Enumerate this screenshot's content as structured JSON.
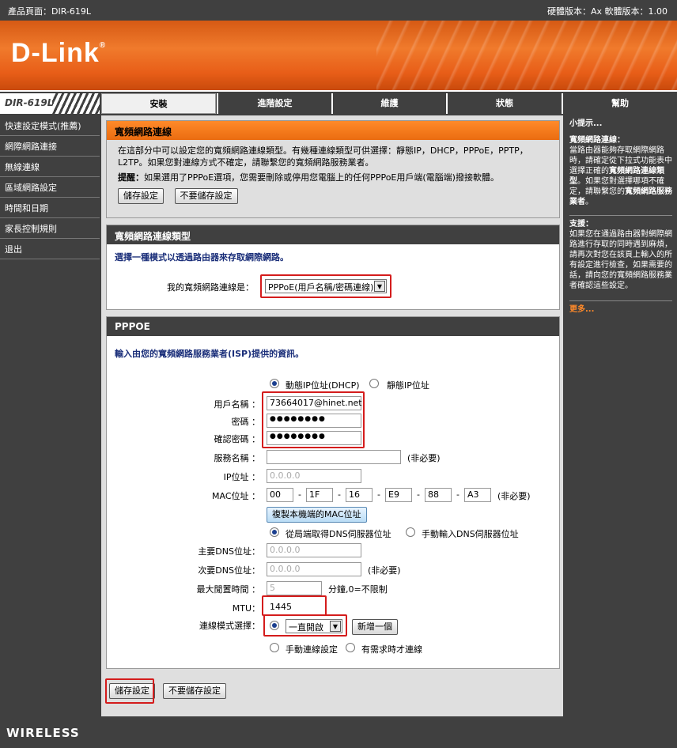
{
  "topbar": {
    "product": "產品頁面：DIR-619L",
    "version": "硬體版本：Ax   軟體版本：1.00"
  },
  "logo": {
    "text": "D-Link",
    "reg": "®"
  },
  "model": "DIR-619L",
  "tabs": [
    "安裝",
    "進階設定",
    "維護",
    "狀態",
    "幫助"
  ],
  "leftmenu": [
    "快速設定模式(推薦)",
    "網際網路連接",
    "無線連線",
    "區域網路設定",
    "時間和日期",
    "家長控制規則",
    "退出"
  ],
  "section1": {
    "title": "寬頻網路連線",
    "desc": "在這部分中可以設定您的寬頻網路連線類型。有幾種連線類型可供選擇：靜態IP，DHCP，PPPoE，PPTP，L2TP。如果您對連線方式不確定，請聯繫您的寬頻網路服務業者。",
    "note_label": "提醒：",
    "note": "如果選用了PPPoE選項，您需要刪除或停用您電腦上的任何PPPoE用戶端(電腦端)撥接軟體。",
    "save": "儲存設定",
    "nosave": "不要儲存設定"
  },
  "section2": {
    "title": "寬頻網路連線類型",
    "subtitle": "選擇一種模式以透過路由器來存取網際網路。",
    "label": "我的寬頻網路連線是：",
    "value": "PPPoE(用戶名稱/密碼連線)"
  },
  "section3": {
    "title": "PPPOE",
    "subtitle": "輸入由您的寬頻網路服務業者(ISP)提供的資訊。",
    "dhcp": "動態IP位址(DHCP)",
    "static": "靜態IP位址",
    "username_label": "用戶名稱 ：",
    "username": "73664017@hinet.net",
    "password_label": "密碼 ：",
    "password": "●●●●●●●●",
    "confirm_label": "確認密碼 ：",
    "confirm": "●●●●●●●●",
    "service_label": "服務名稱 ：",
    "optional": "(非必要)",
    "ip_label": "IP位址 ：",
    "ip_placeholder": "0.0.0.0",
    "mac_label": "MAC位址 ：",
    "mac": [
      "00",
      "1F",
      "16",
      "E9",
      "88",
      "A3"
    ],
    "mac_sep": "-",
    "clone": "複製本機端的MAC位址",
    "dns_auto": "從局端取得DNS伺服器位址",
    "dns_manual": "手動輸入DNS伺服器位址",
    "dns1_label": "主要DNS位址：",
    "dns2_label": "次要DNS位址：",
    "dns_placeholder": "0.0.0.0",
    "idle_label": "最大閒置時間 ：",
    "idle": "5",
    "idle_unit": "分鐘,0=不限制",
    "mtu_label": "MTU：",
    "mtu": "1445",
    "mode_label": "連線模式選擇：",
    "mode_value": "一直開啟",
    "add": "新增一個",
    "manual": "手動連線設定",
    "ondemand": "有需求時才連線"
  },
  "bottom": {
    "save": "儲存設定",
    "nosave": "不要儲存設定"
  },
  "hints": {
    "title": "小提示...",
    "h1_title": "寬頻網路連線：",
    "h1_a": "當路由器能夠存取網際網路時，請確定從下拉式功能表中選擇正確的",
    "h1_b": "寬頻網路連線類型",
    "h1_c": "。如果您對選擇哪項不確定，請聯繫您的",
    "h1_d": "寬頻網路服務業者",
    "h1_e": "。",
    "h2_title": "支援：",
    "h2": "如果您在通過路由器對網際網路進行存取的同時遇到麻煩，請再次對您在該頁上輸入的所有設定進行檢查，如果需要的話，請向您的寬頻網路服務業者確認這些設定。",
    "more": "更多..."
  },
  "footer": "WIRELESS",
  "colors": {
    "orange": "#f07a2c",
    "dark": "#404040",
    "highlight": "#d41c1c"
  }
}
